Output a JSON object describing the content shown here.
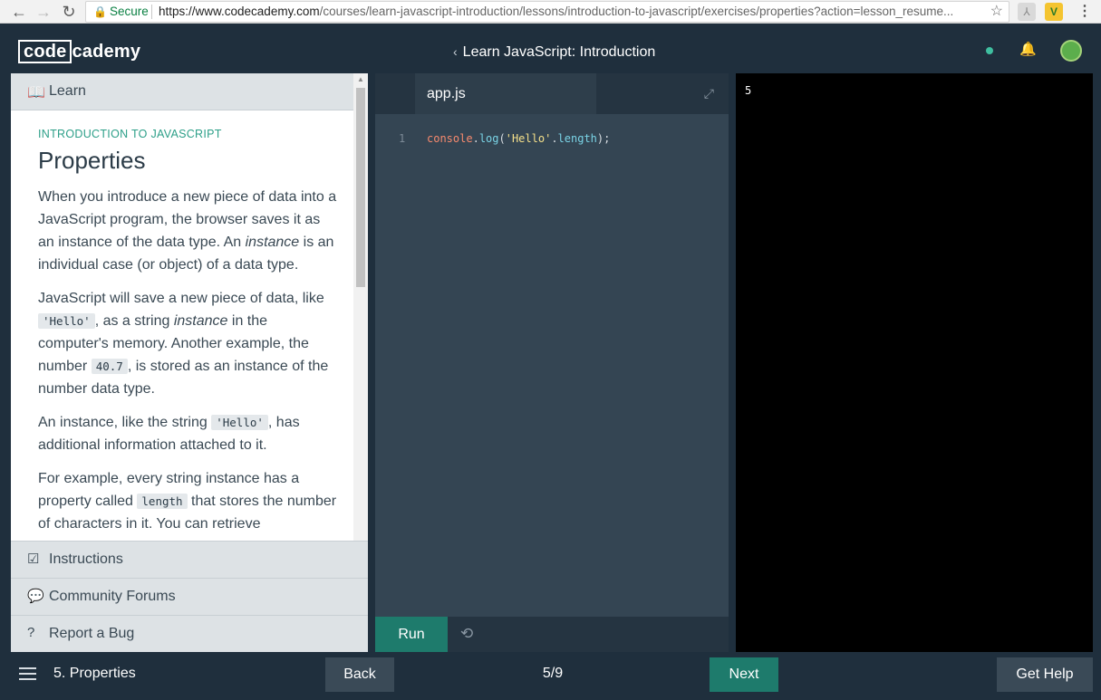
{
  "browser": {
    "secure_label": "Secure",
    "url_host": "https://www.codecademy.com",
    "url_path": "/courses/learn-javascript-introduction/lessons/introduction-to-javascript/exercises/properties?action=lesson_resume..."
  },
  "header": {
    "logo_box": "code",
    "logo_rest": "cademy",
    "course_title": "Learn JavaScript: Introduction",
    "status_color": "#3fbfa0"
  },
  "lesson": {
    "learn_tab": "Learn",
    "kicker": "INTRODUCTION TO JAVASCRIPT",
    "title": "Properties",
    "p1": {
      "a": "When you introduce a new piece of data into a JavaScript program, the browser saves it as an instance of the data type. An ",
      "em": "instance",
      "b": " is an individual case (or object) of a data type."
    },
    "p2": {
      "a": "JavaScript will save a new piece of data, like ",
      "code1": "'Hello'",
      "b": ", as a string ",
      "em": "instance",
      "c": " in the computer's memory. Another example, the number ",
      "code2": "40.7",
      "d": ", is stored as an instance of the number data type."
    },
    "p3": {
      "a": "An instance, like the string ",
      "code": "'Hello'",
      "b": ", has additional information attached to it."
    },
    "p4": {
      "a": "For example, every string instance has a property called ",
      "code": "length",
      "b": " that stores the number of characters in it. You can retrieve"
    },
    "items": [
      {
        "label": "Instructions",
        "icon": "checkbox-icon"
      },
      {
        "label": "Community Forums",
        "icon": "chat-icon"
      },
      {
        "label": "Report a Bug",
        "icon": "question-icon"
      }
    ]
  },
  "editor": {
    "file_tab": "app.js",
    "line_number": "1",
    "code": {
      "obj": "console",
      "dot1": ".",
      "fn": "log",
      "open": "(",
      "str": "'Hello'",
      "dot2": ".",
      "prop": "length",
      "close": ");"
    },
    "run_label": "Run"
  },
  "output": {
    "text": "5"
  },
  "footer": {
    "lesson_name": "5. Properties",
    "back_label": "Back",
    "progress": "5/9",
    "next_label": "Next",
    "help_label": "Get Help"
  }
}
